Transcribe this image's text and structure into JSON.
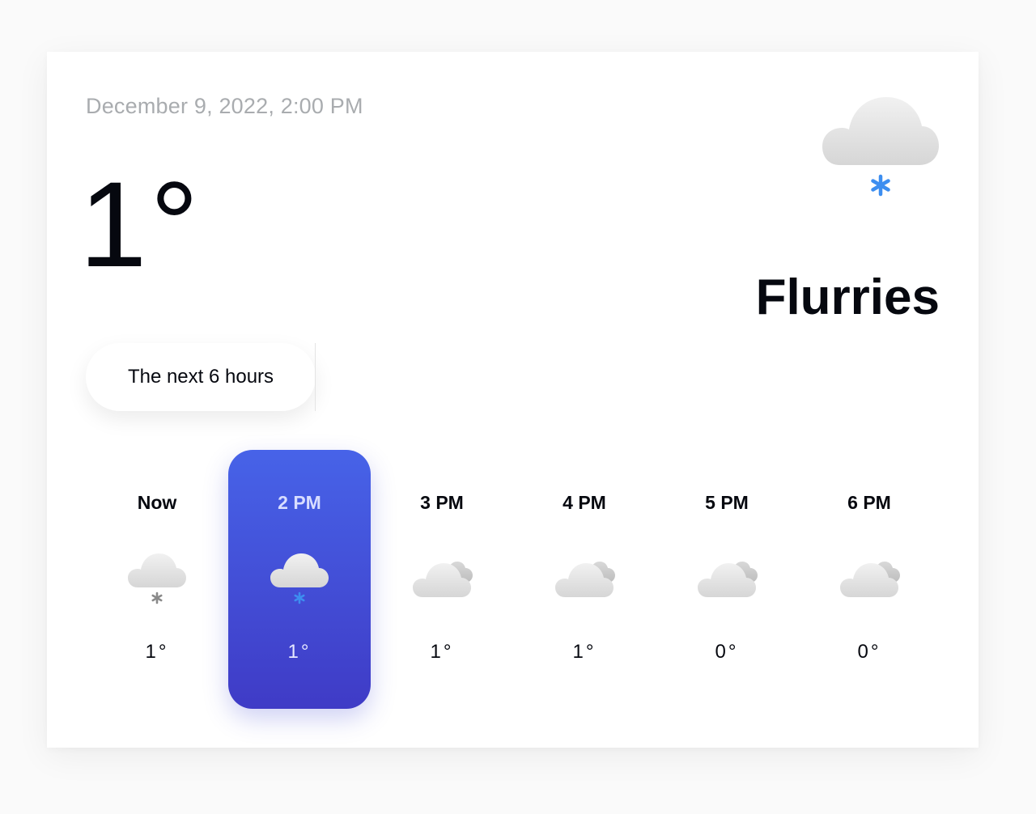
{
  "header": {
    "datetime": "December 9, 2022, 2:00 PM",
    "temperature": "1°",
    "condition": "Flurries",
    "condition_icon": "cloud-snow-icon"
  },
  "range_selector": {
    "label": "The next 6 hours"
  },
  "hourly": [
    {
      "label": "Now",
      "temp": "1°",
      "icon": "cloud-snow-icon",
      "selected": false
    },
    {
      "label": "2 PM",
      "temp": "1°",
      "icon": "cloud-snow-icon",
      "selected": true
    },
    {
      "label": "3 PM",
      "temp": "1°",
      "icon": "cloudy-icon",
      "selected": false
    },
    {
      "label": "4 PM",
      "temp": "1°",
      "icon": "cloudy-icon",
      "selected": false
    },
    {
      "label": "5 PM",
      "temp": "0°",
      "icon": "cloudy-icon",
      "selected": false
    },
    {
      "label": "6 PM",
      "temp": "0°",
      "icon": "cloudy-icon",
      "selected": false
    }
  ],
  "colors": {
    "accent_top": "#4763e8",
    "accent_bottom": "#3f3bc6",
    "snowflake": "#3d8ef0"
  }
}
